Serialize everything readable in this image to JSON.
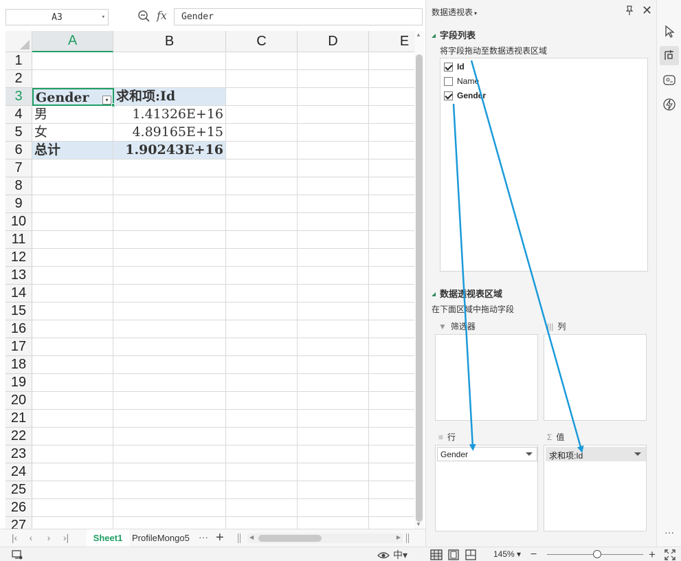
{
  "formula_bar": {
    "name_box": "A3",
    "formula_value": "Gender"
  },
  "grid": {
    "columns": [
      "A",
      "B",
      "C",
      "D",
      "E"
    ],
    "rows": [
      "1",
      "2",
      "3",
      "4",
      "5",
      "6",
      "7",
      "8",
      "9",
      "10",
      "11",
      "12",
      "13",
      "14",
      "15",
      "16",
      "17",
      "18",
      "19",
      "20",
      "21",
      "22",
      "23",
      "24",
      "25",
      "26",
      "27"
    ],
    "cells": {
      "a3": "Gender",
      "b3": "求和项:Id",
      "a4": "男",
      "b4": "1.41326E+16",
      "a5": "女",
      "b5": "4.89165E+15",
      "a6": "总计",
      "b6": "1.90243E+16"
    }
  },
  "sheet_tabs": {
    "active": "Sheet1",
    "other": "ProfileMongo5",
    "more": "···",
    "add": "+"
  },
  "status_bar": {
    "zoom_level": "145%",
    "zoom_fraction": 0.52
  },
  "pivot_panel": {
    "title": "数据透视表",
    "field_list_heading": "字段列表",
    "field_list_hint": "将字段拖动至数据透视表区域",
    "fields": [
      {
        "label": "Id",
        "checked": true
      },
      {
        "label": "Name",
        "checked": false
      },
      {
        "label": "Gender",
        "checked": true
      }
    ],
    "areas_heading": "数据透视表区域",
    "areas_hint": "在下面区域中拖动字段",
    "filter_label": "筛选器",
    "columns_label": "列",
    "rows_label": "行",
    "values_label": "值",
    "rows_chip": "Gender",
    "values_chip": "求和项:Id"
  },
  "colors": {
    "accent": "#1e9e63",
    "highlight": "#dce9f5",
    "annotation_arrow": "#1a9ad9"
  }
}
